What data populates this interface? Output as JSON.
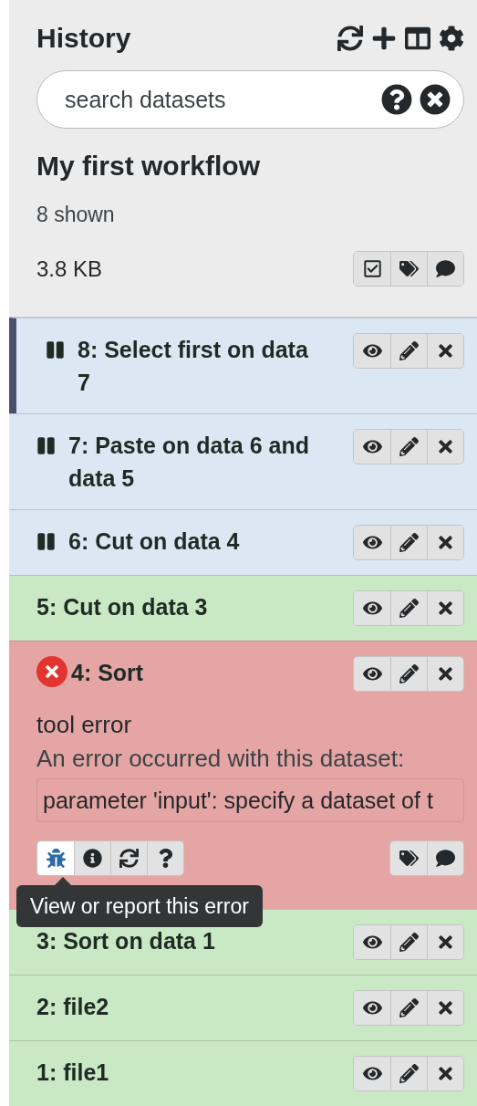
{
  "panel": {
    "title": "History",
    "search": {
      "placeholder": "search datasets"
    },
    "history_name": "My first workflow",
    "shown_count": "8 shown",
    "size": "3.8 KB"
  },
  "datasets": [
    {
      "title": "8: Select first on data 7",
      "kind": "paused",
      "selected": true
    },
    {
      "title": "7: Paste on data 6 and data 5",
      "kind": "paused",
      "selected": false
    },
    {
      "title": "6: Cut on data 4",
      "kind": "paused",
      "selected": false
    },
    {
      "title": "5: Cut on data 3",
      "kind": "ok",
      "selected": false
    },
    {
      "title": "4: Sort",
      "kind": "error",
      "selected": false,
      "summary": "tool error",
      "message": "An error occurred with this dataset:",
      "error_detail": "parameter 'input': specify a dataset of t",
      "tooltip": "View or report this error"
    },
    {
      "title": "3: Sort on data 1",
      "kind": "ok",
      "selected": false
    },
    {
      "title": "2: file2",
      "kind": "ok",
      "selected": false
    },
    {
      "title": "1: file1",
      "kind": "ok",
      "selected": false
    }
  ]
}
